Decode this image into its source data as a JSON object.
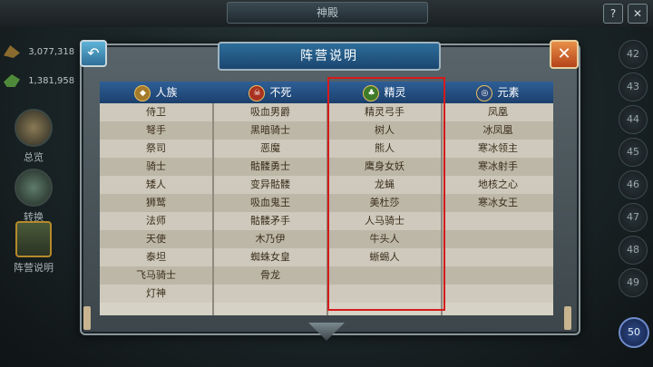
{
  "top": {
    "title": "神殿",
    "help": "?",
    "close": "✕"
  },
  "resources": [
    {
      "value": "3,077,318"
    },
    {
      "value": "1,381,958"
    }
  ],
  "side": {
    "overview": "总览",
    "convert": "转换",
    "faction": "阵营说明"
  },
  "levels": [
    "42",
    "43",
    "44",
    "45",
    "46",
    "47",
    "48",
    "49",
    "50"
  ],
  "dialog": {
    "title": "阵营说明",
    "back": "↶",
    "close": "✕"
  },
  "factions": [
    {
      "name": "人族",
      "icon": "human-crest-icon"
    },
    {
      "name": "不死",
      "icon": "skull-crest-icon"
    },
    {
      "name": "精灵",
      "icon": "elf-leaf-icon"
    },
    {
      "name": "元素",
      "icon": "element-swirl-icon"
    }
  ],
  "columns": {
    "human": [
      "侍卫",
      "弩手",
      "祭司",
      "骑士",
      "矮人",
      "狮鹫",
      "法师",
      "天使",
      "泰坦",
      "飞马骑士",
      "灯神"
    ],
    "undead": [
      "吸血男爵",
      "黑暗骑士",
      "恶魔",
      "骷髅勇士",
      "变异骷髅",
      "吸血鬼王",
      "骷髅矛手",
      "木乃伊",
      "蜘蛛女皇",
      "骨龙",
      ""
    ],
    "elf": [
      "精灵弓手",
      "树人",
      "熊人",
      "鹰身女妖",
      "龙蝇",
      "美杜莎",
      "人马骑士",
      "牛头人",
      "蜥蜴人",
      "",
      ""
    ],
    "element": [
      "凤凰",
      "冰凤凰",
      "寒冰领主",
      "寒冰射手",
      "地核之心",
      "寒冰女王",
      "",
      "",
      "",
      "",
      ""
    ]
  },
  "colors": {
    "header_blue": "#2e5f97",
    "highlight_red": "#d61a1a",
    "active_level": "#2f4c8a"
  }
}
